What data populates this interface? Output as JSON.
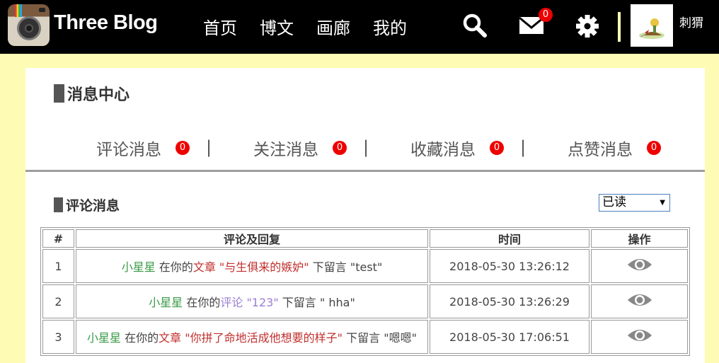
{
  "brand": {
    "title": "Three Blog"
  },
  "nav": {
    "items": [
      "首页",
      "博文",
      "画廊",
      "我的"
    ]
  },
  "header": {
    "mail_count": "0",
    "username": "刺猬"
  },
  "page": {
    "title": "消息中心"
  },
  "tabs": [
    {
      "label": "评论消息",
      "count": "0"
    },
    {
      "label": "关注消息",
      "count": "0"
    },
    {
      "label": "收藏消息",
      "count": "0"
    },
    {
      "label": "点赞消息",
      "count": "0"
    }
  ],
  "tab_separator": "|",
  "comments": {
    "title": "评论消息",
    "filter": {
      "selected": "已读"
    },
    "columns": [
      "#",
      "评论及回复",
      "时间",
      "操作"
    ],
    "rows": [
      {
        "index": "1",
        "user": "小星星",
        "in_text": "在你的",
        "target_type": "文章",
        "target": "\"与生俱来的嫉妒\"",
        "after": "下留言",
        "message": "\"test\"",
        "time": "2018-05-30 13:26:12"
      },
      {
        "index": "2",
        "user": "小星星",
        "in_text": "在你的",
        "target_type": "评论",
        "target": "\"123\"",
        "after": "下留言",
        "message": "\" hha\"",
        "time": "2018-05-30 13:26:29"
      },
      {
        "index": "3",
        "user": "小星星",
        "in_text": "在你的",
        "target_type": "文章",
        "target": "\"你拼了命地活成他想要的样子\"",
        "after": "下留言",
        "message": "\"嗯嗯\"",
        "time": "2018-05-30 17:06:51"
      }
    ]
  },
  "colors": {
    "background": "#fefcb4",
    "topbar": "#000000",
    "badge": "#ee0000",
    "username_link": "#3a9a47",
    "article_link": "#c0302e",
    "comment_link": "#9b7dd4"
  },
  "icons": [
    "camera-logo-icon",
    "search-icon",
    "mail-icon",
    "gear-icon",
    "eye-icon"
  ]
}
